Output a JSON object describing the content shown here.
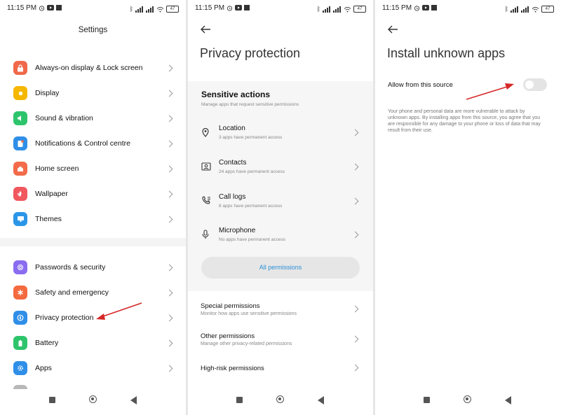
{
  "status_bar": {
    "time": "11:15 PM",
    "battery": "47"
  },
  "panel1": {
    "title": "Settings",
    "items": [
      {
        "label": "Always-on display & Lock screen",
        "icon": "lock-icon",
        "color": "#f0694a"
      },
      {
        "label": "Display",
        "icon": "sun-icon",
        "color": "#f5b700"
      },
      {
        "label": "Sound & vibration",
        "icon": "speaker-icon",
        "color": "#2ec46c"
      },
      {
        "label": "Notifications & Control centre",
        "icon": "notification-icon",
        "color": "#2f8fe8"
      },
      {
        "label": "Home screen",
        "icon": "home-icon",
        "color": "#f36b4a"
      },
      {
        "label": "Wallpaper",
        "icon": "flower-icon",
        "color": "#f0575e"
      },
      {
        "label": "Themes",
        "icon": "monitor-icon",
        "color": "#2b96e8"
      },
      {
        "label": "Passwords & security",
        "icon": "fingerprint-icon",
        "color": "#8a6cf0"
      },
      {
        "label": "Safety and emergency",
        "icon": "asterisk-icon",
        "color": "#f46a3f"
      },
      {
        "label": "Privacy protection",
        "icon": "privacy-icon",
        "color": "#2f8fe8"
      },
      {
        "label": "Battery",
        "icon": "battery-icon",
        "color": "#2ec46c"
      },
      {
        "label": "Apps",
        "icon": "gear-icon",
        "color": "#2f8fe8"
      }
    ]
  },
  "panel2": {
    "title": "Privacy protection",
    "sensitive_title": "Sensitive actions",
    "sensitive_sub": "Manage apps that request sensitive permissions",
    "perms": [
      {
        "title": "Location",
        "sub": "3 apps have permanent access",
        "icon": "location-icon"
      },
      {
        "title": "Contacts",
        "sub": "24 apps have permanent access",
        "icon": "contacts-icon"
      },
      {
        "title": "Call logs",
        "sub": "8 apps have permanent access",
        "icon": "call-log-icon"
      },
      {
        "title": "Microphone",
        "sub": "No apps have permanent access",
        "icon": "microphone-icon"
      }
    ],
    "all_permissions": "All permissions",
    "special": [
      {
        "title": "Special permissions",
        "sub": "Monitor how apps use sensitive permissions"
      },
      {
        "title": "Other permissions",
        "sub": "Manage other privacy-related permissions"
      },
      {
        "title": "High-risk permissions",
        "sub": ""
      }
    ]
  },
  "panel3": {
    "title": "Install unknown apps",
    "allow_label": "Allow from this source",
    "allow_enabled": false,
    "description": "Your phone and personal data are more vulnerable to attack by unknown apps. By installing apps from this source, you agree that you are responsible for any damage to your phone or loss of data that may result from their use."
  },
  "colors": {
    "arrow": "#d62828",
    "link": "#2b8fd8"
  }
}
